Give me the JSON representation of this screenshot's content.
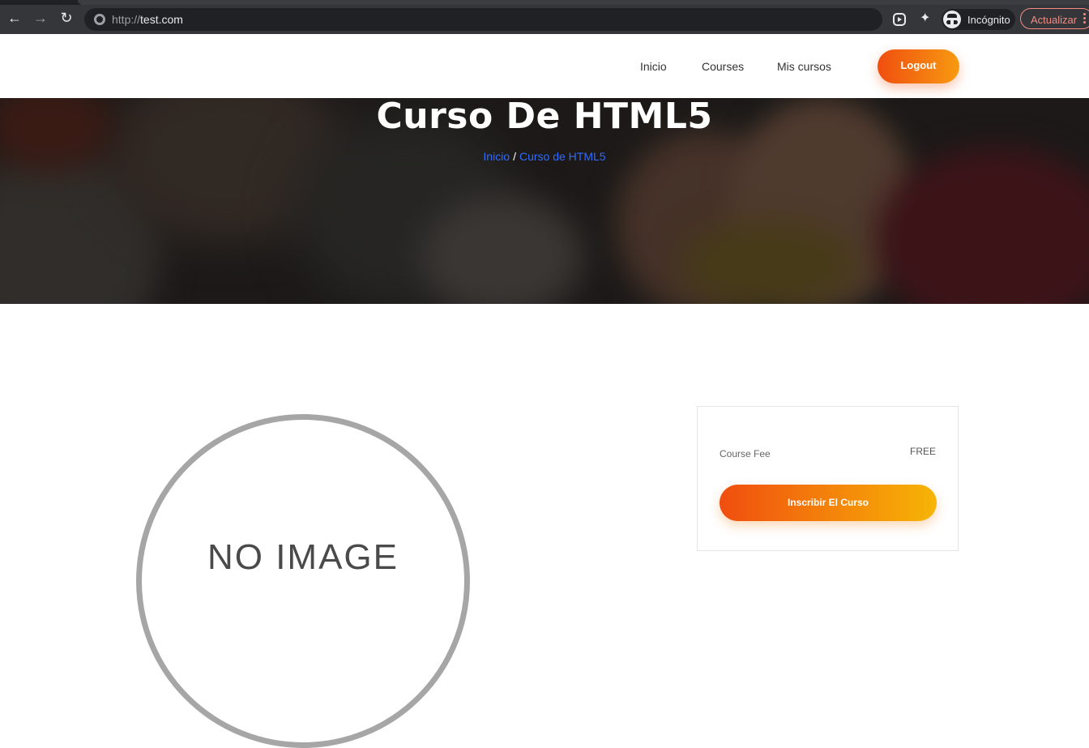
{
  "browser": {
    "url_scheme": "http://",
    "url_host": "test.com",
    "incognito_label": "Incógnito",
    "update_label": "Actualizar"
  },
  "nav": {
    "items": [
      {
        "label": "Inicio"
      },
      {
        "label": "Courses"
      },
      {
        "label": "Mis cursos"
      }
    ],
    "logout_label": "Logout"
  },
  "hero": {
    "title": "Curso De HTML5",
    "breadcrumb": {
      "home": "Inicio",
      "separator": "/",
      "current": "Curso de HTML5"
    }
  },
  "course": {
    "image_placeholder": "NO IMAGE",
    "fee_label": "Course Fee",
    "fee_value": "FREE",
    "enroll_label": "Inscribir El Curso"
  },
  "colors": {
    "accent_start": "#f04e0f",
    "accent_end": "#f7b506",
    "breadcrumb_link": "#2f6bff"
  }
}
